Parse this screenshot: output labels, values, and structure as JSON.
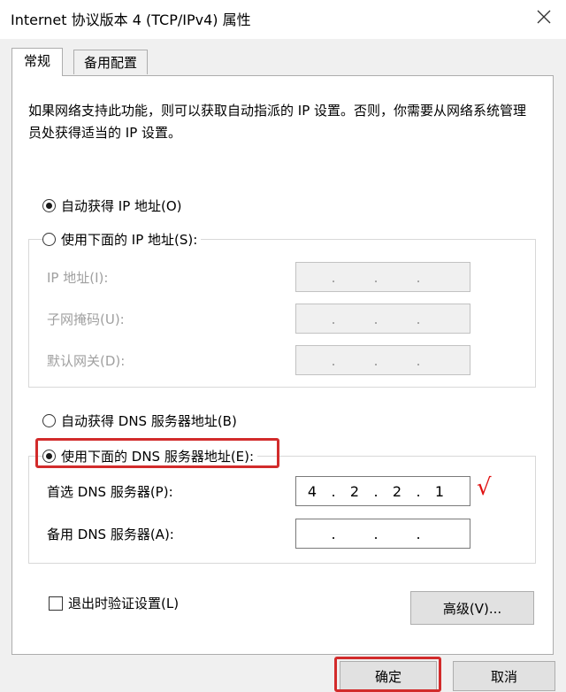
{
  "window": {
    "title": "Internet 协议版本 4 (TCP/IPv4) 属性"
  },
  "tabs": [
    {
      "label": "常规"
    },
    {
      "label": "备用配置"
    }
  ],
  "description": "如果网络支持此功能，则可以获取自动指派的 IP 设置。否则，你需要从网络系统管理员处获得适当的 IP 设置。",
  "ip_section": {
    "auto_label": "自动获得 IP 地址(O)",
    "manual_label": "使用下面的 IP 地址(S):",
    "selected": "auto",
    "fields": [
      {
        "label": "IP 地址(I):",
        "value": ". . ."
      },
      {
        "label": "子网掩码(U):",
        "value": ". . ."
      },
      {
        "label": "默认网关(D):",
        "value": ". . ."
      }
    ]
  },
  "dns_section": {
    "auto_label": "自动获得 DNS 服务器地址(B)",
    "manual_label": "使用下面的 DNS 服务器地址(E):",
    "selected": "manual",
    "preferred": {
      "label": "首选 DNS 服务器(P):",
      "octets": [
        "4",
        "2",
        "2",
        "1"
      ]
    },
    "alternate": {
      "label": "备用 DNS 服务器(A):",
      "octets": [
        "",
        "",
        "",
        ""
      ]
    }
  },
  "validate_label": "退出时验证设置(L)",
  "buttons": {
    "advanced": "高级(V)...",
    "ok": "确定",
    "cancel": "取消"
  },
  "annotation": {
    "checkmark": "√",
    "color": "#e01010",
    "highlight_color": "#d22b2b"
  }
}
